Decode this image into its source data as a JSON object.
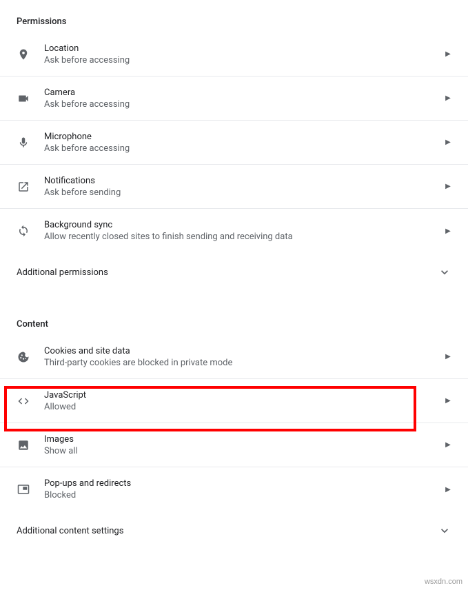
{
  "permissions": {
    "header": "Permissions",
    "items": [
      {
        "title": "Location",
        "subtitle": "Ask before accessing"
      },
      {
        "title": "Camera",
        "subtitle": "Ask before accessing"
      },
      {
        "title": "Microphone",
        "subtitle": "Ask before accessing"
      },
      {
        "title": "Notifications",
        "subtitle": "Ask before sending"
      },
      {
        "title": "Background sync",
        "subtitle": "Allow recently closed sites to finish sending and receiving data"
      }
    ],
    "additional": "Additional permissions"
  },
  "content": {
    "header": "Content",
    "items": [
      {
        "title": "Cookies and site data",
        "subtitle": "Third-party cookies are blocked in private mode"
      },
      {
        "title": "JavaScript",
        "subtitle": "Allowed"
      },
      {
        "title": "Images",
        "subtitle": "Show all"
      },
      {
        "title": "Pop-ups and redirects",
        "subtitle": "Blocked"
      }
    ],
    "additional": "Additional content settings"
  },
  "watermark": "wsxdn.com"
}
